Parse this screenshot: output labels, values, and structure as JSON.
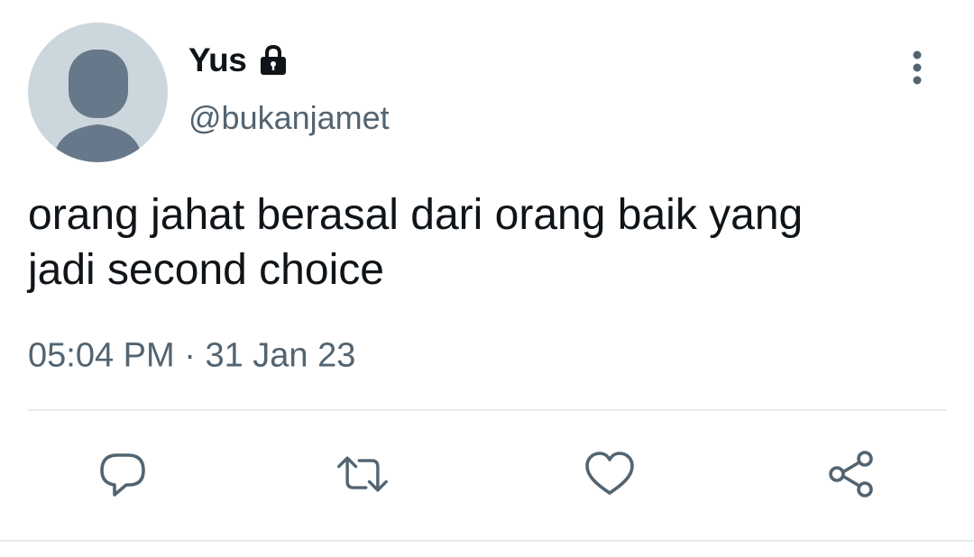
{
  "author": {
    "display_name": "Yus",
    "handle": "@bukanjamet",
    "avatar_icon": "default-avatar-icon",
    "protected_icon": "lock-icon"
  },
  "tweet": {
    "text": "orang jahat berasal dari orang baik yang\njadi second choice",
    "time": "05:04 PM",
    "separator": "·",
    "date": "31 Jan 23"
  },
  "actions": {
    "reply_icon": "reply-icon",
    "retweet_icon": "retweet-icon",
    "like_icon": "heart-icon",
    "share_icon": "share-icon",
    "more_icon": "more-vertical-icon"
  },
  "colors": {
    "text_primary": "#0f1419",
    "text_secondary": "#536471",
    "avatar_bg": "#ccd6dd",
    "avatar_fg": "#66788a",
    "divider": "#e6ecf0"
  }
}
